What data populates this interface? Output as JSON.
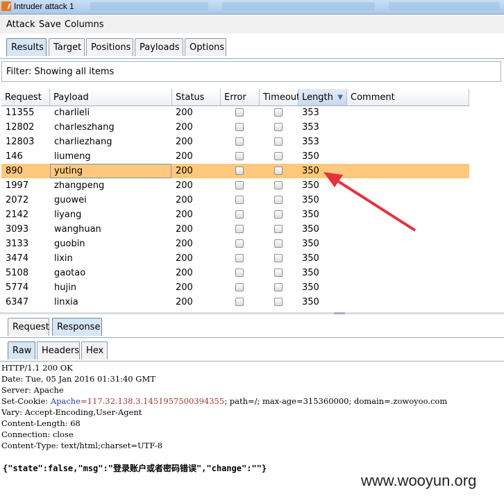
{
  "window": {
    "title": "Intruder attack 1"
  },
  "menu": [
    "Attack",
    "Save",
    "Columns"
  ],
  "main_tabs": [
    "Results",
    "Target",
    "Positions",
    "Payloads",
    "Options"
  ],
  "filter": {
    "text": "Filter: Showing all items"
  },
  "table": {
    "columns": [
      "Request",
      "Payload",
      "Status",
      "Error",
      "Timeout",
      "Length",
      "Comment"
    ],
    "rows": [
      {
        "request": "11355",
        "payload": "charlieli",
        "status": "200",
        "length": "353"
      },
      {
        "request": "12802",
        "payload": "charleszhang",
        "status": "200",
        "length": "353"
      },
      {
        "request": "12803",
        "payload": "charliezhang",
        "status": "200",
        "length": "353"
      },
      {
        "request": "146",
        "payload": "liumeng",
        "status": "200",
        "length": "350"
      },
      {
        "request": "890",
        "payload": "yuting",
        "status": "200",
        "length": "350"
      },
      {
        "request": "1997",
        "payload": "zhangpeng",
        "status": "200",
        "length": "350"
      },
      {
        "request": "2072",
        "payload": "guowei",
        "status": "200",
        "length": "350"
      },
      {
        "request": "2142",
        "payload": "liyang",
        "status": "200",
        "length": "350"
      },
      {
        "request": "3093",
        "payload": "wanghuan",
        "status": "200",
        "length": "350"
      },
      {
        "request": "3133",
        "payload": "guobin",
        "status": "200",
        "length": "350"
      },
      {
        "request": "3474",
        "payload": "lixin",
        "status": "200",
        "length": "350"
      },
      {
        "request": "5108",
        "payload": "gaotao",
        "status": "200",
        "length": "350"
      },
      {
        "request": "5774",
        "payload": "hujin",
        "status": "200",
        "length": "350"
      },
      {
        "request": "6347",
        "payload": "linxia",
        "status": "200",
        "length": "350"
      }
    ]
  },
  "detail_tabs": [
    "Request",
    "Response"
  ],
  "view_tabs": [
    "Raw",
    "Headers",
    "Hex"
  ],
  "response": {
    "lines": [
      "HTTP/1.1 200 OK",
      "Date: Tue, 05 Jan 2016 01:31:40 GMT",
      "Server: Apache",
      "Vary: Accept-Encoding,User-Agent",
      "Content-Length: 68",
      "Connection: close",
      "Content-Type: text/html;charset=UTF-8"
    ],
    "cookie_prefix": "Set-Cookie: ",
    "cookie_name": "Apache",
    "cookie_value": "=117.32.138.3.1451957500394355",
    "cookie_rest": "; path=/; max-age=315360000; domain=.zowoyoo.com",
    "body": "{\"state\":false,\"msg\":\"登录账户或者密码错误\",\"change\":\"\"}"
  },
  "watermark": "www.wooyun.org",
  "colors": {
    "selected_row": "#ffc87c",
    "arrow": "#e8303a"
  }
}
